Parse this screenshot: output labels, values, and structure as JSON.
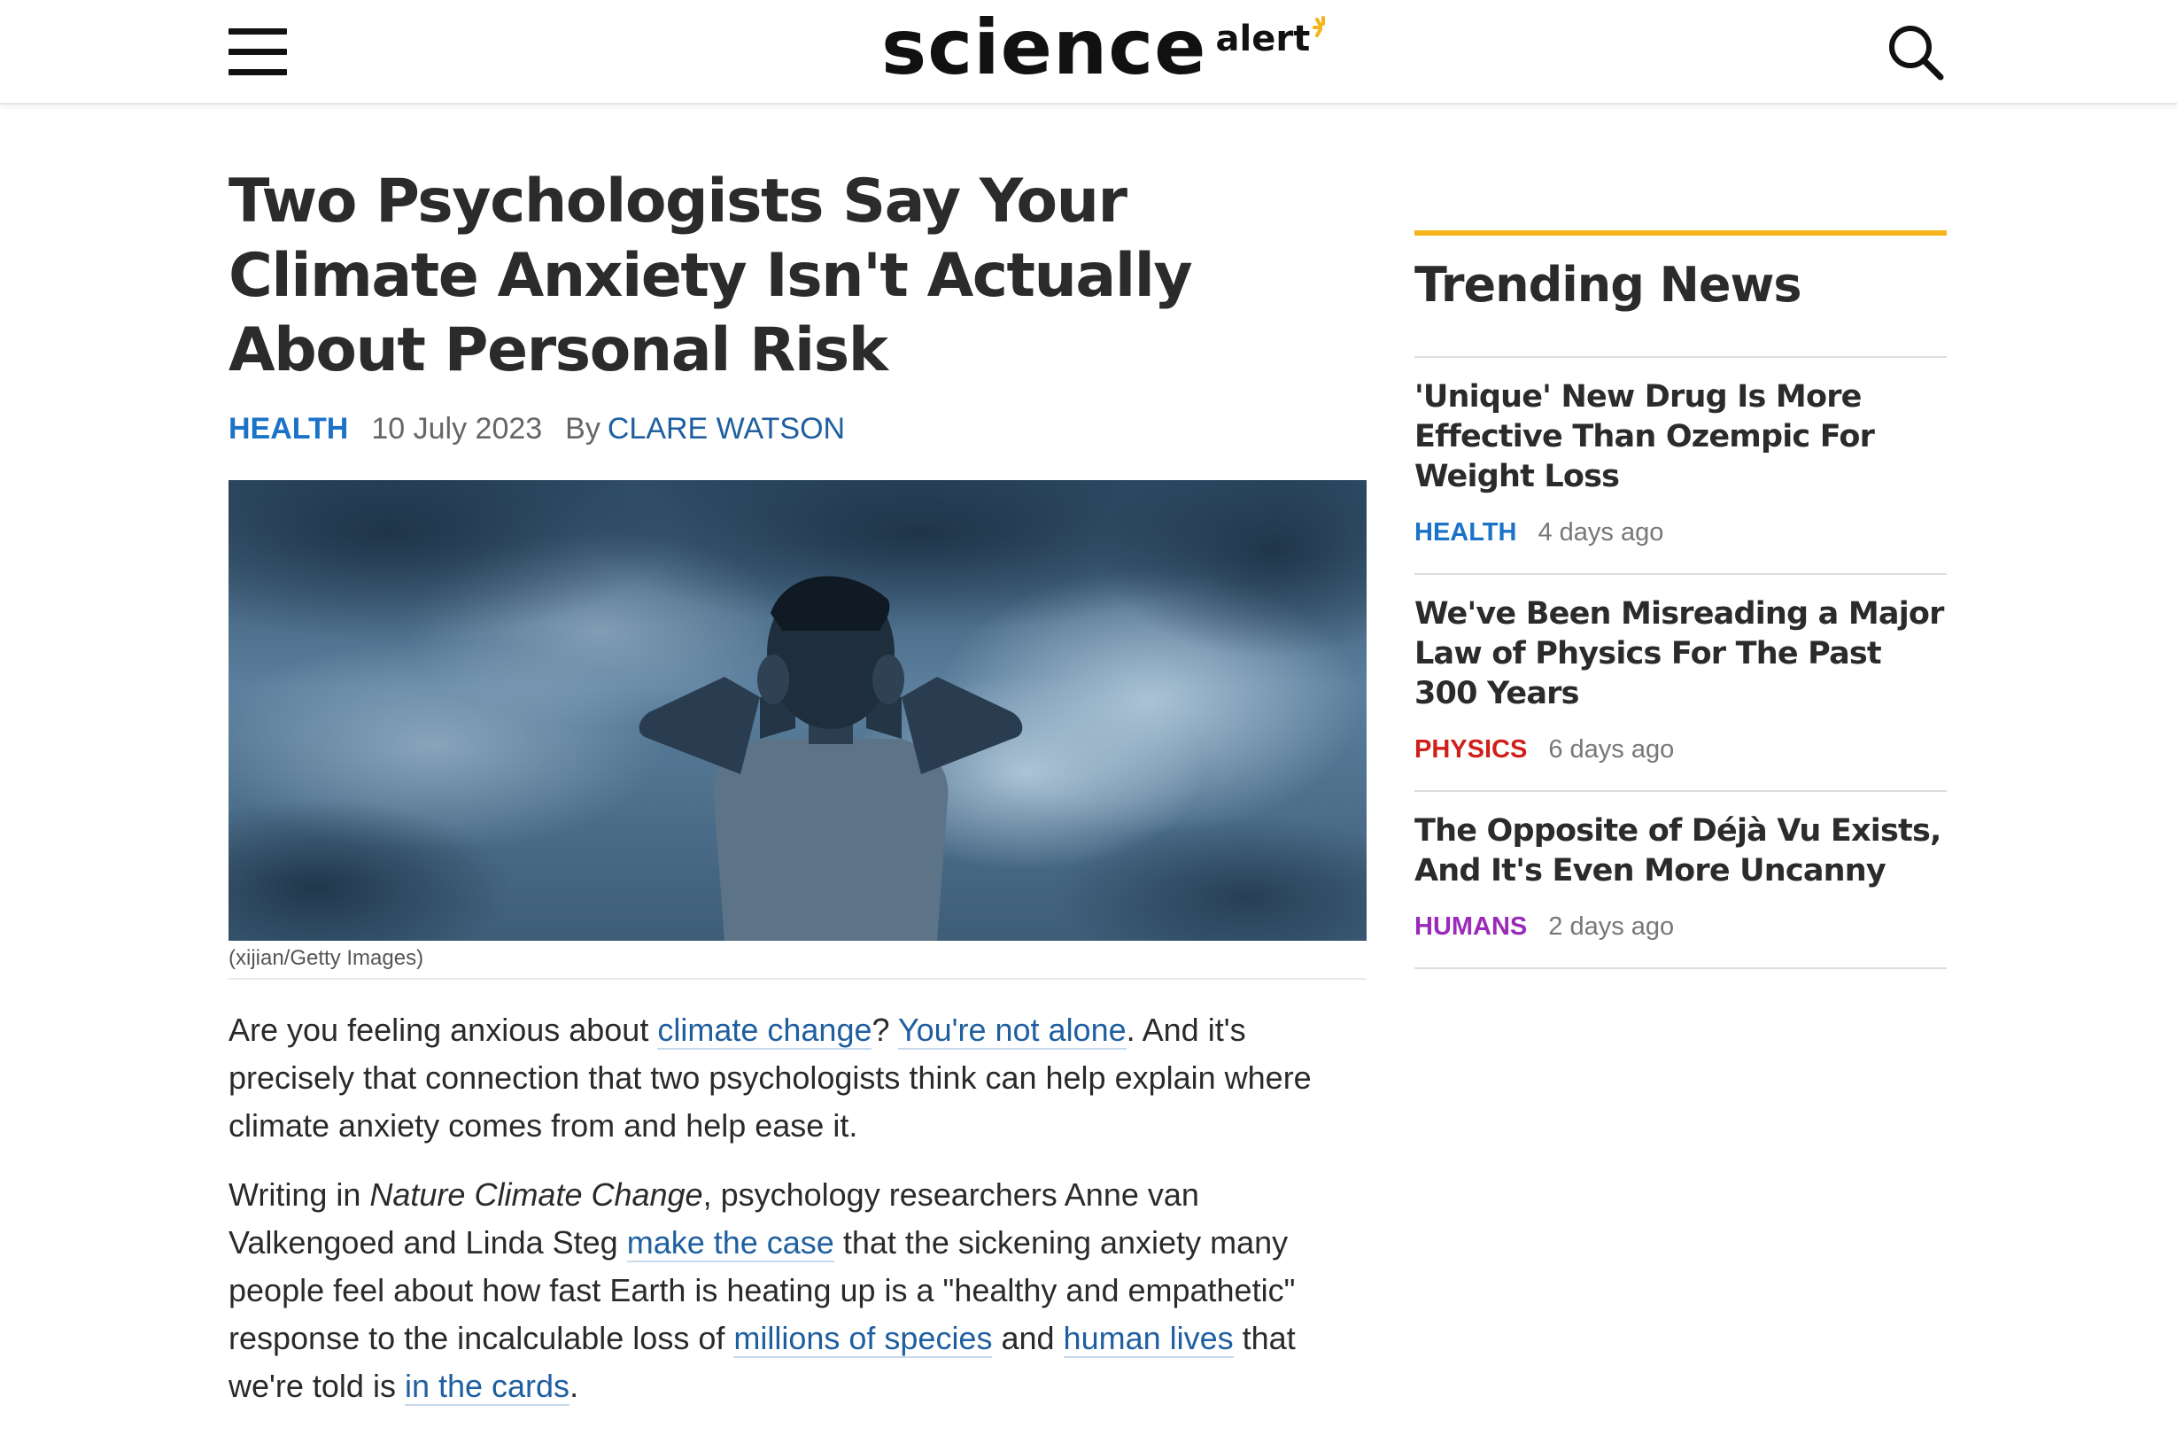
{
  "header": {
    "logo_main": "science",
    "logo_sub": "alert"
  },
  "article": {
    "title": "Two Psychologists Say Your Climate Anxiety Isn't Actually About Personal Risk",
    "category": "HEALTH",
    "date": "10 July 2023",
    "by_label": "By",
    "author": "CLARE WATSON",
    "image_caption": "(xijian/Getty Images)",
    "p1": {
      "t1": "Are you feeling anxious about ",
      "l1": "climate change",
      "t2": "? ",
      "l2": "You're not alone",
      "t3": ". And it's precisely that connection that two psychologists think can help explain where climate anxiety comes from and help ease it."
    },
    "p2": {
      "t1": "Writing in ",
      "em1": "Nature Climate Change",
      "t2": ", psychology researchers Anne van Valkengoed and Linda Steg ",
      "l1": "make the case",
      "t3": " that the sickening anxiety many people feel about how fast Earth is heating up is a \"healthy and empathetic\" response to the incalculable loss of ",
      "l2": "millions of species",
      "t4": " and ",
      "l3": "human lives",
      "t5": " that we're told is ",
      "l4": "in the cards",
      "t6": "."
    }
  },
  "sidebar": {
    "heading": "Trending News",
    "items": [
      {
        "title": "'Unique' New Drug Is More Effective Than Ozempic For Weight Loss",
        "category": "HEALTH",
        "category_color": "#1b73c8",
        "time": "4 days ago"
      },
      {
        "title": "We've Been Misreading a Major Law of Physics For The Past 300 Years",
        "category": "PHYSICS",
        "category_color": "#d0201b",
        "time": "6 days ago"
      },
      {
        "title": "The Opposite of Déjà Vu Exists, And It's Even More Uncanny",
        "category": "HUMANS",
        "category_color": "#9a2bb8",
        "time": "2 days ago"
      }
    ]
  },
  "colors": {
    "link": "#1f5fa0",
    "health": "#1b73c8",
    "accent": "#f4b41a"
  },
  "icons": {
    "menu": "hamburger-menu-icon",
    "search": "search-icon",
    "logo_star": "star-burst-icon"
  }
}
